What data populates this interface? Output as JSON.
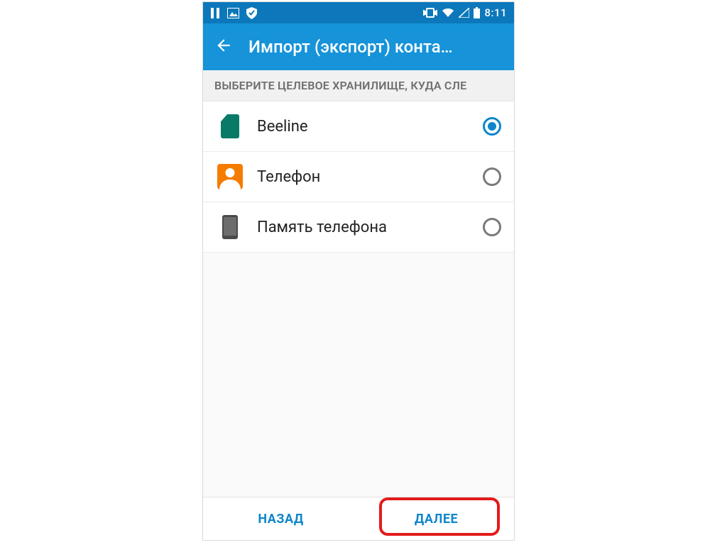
{
  "statusbar": {
    "time": "8:11"
  },
  "appbar": {
    "title": "Импорт (экспорт) конта…"
  },
  "section_header": "ВЫБЕРИТЕ ЦЕЛЕВОЕ ХРАНИЛИЩЕ, КУДА СЛЕ",
  "options": [
    {
      "label": "Beeline",
      "icon": "sim",
      "selected": true
    },
    {
      "label": "Телефон",
      "icon": "contact",
      "selected": false
    },
    {
      "label": "Память телефона",
      "icon": "storage",
      "selected": false
    }
  ],
  "footer": {
    "back": "НАЗАД",
    "next": "ДАЛЕЕ"
  },
  "colors": {
    "statusbar_bg": "#0c78bb",
    "appbar_bg": "#1693d9",
    "accent": "#0f86cc",
    "highlight": "#e31b1b"
  }
}
